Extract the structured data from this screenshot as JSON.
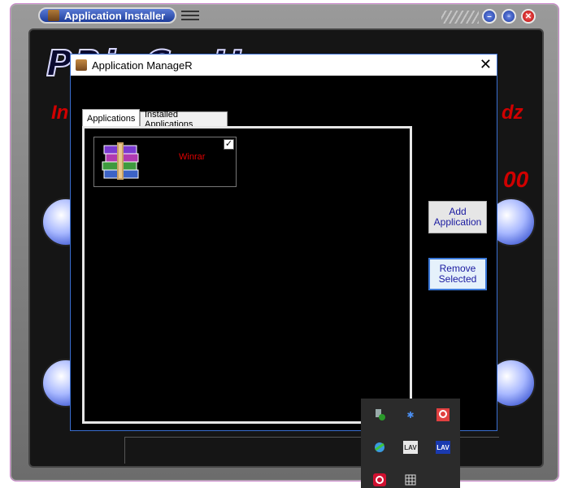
{
  "installer": {
    "title": "Application Installer",
    "brand_title": "PRinCe Hassan",
    "tagline_left": "In",
    "tagline_right": "dz",
    "number_text": "00"
  },
  "dialog": {
    "title": "Application ManageR",
    "close_glyph": "✕",
    "tabs": [
      {
        "label": "Applications",
        "active": true
      },
      {
        "label": "Installed Applications",
        "active": false
      }
    ],
    "apps": [
      {
        "name": "Winrar",
        "checked": true,
        "check_glyph": "✓"
      }
    ],
    "buttons": {
      "add_line1": "Add",
      "add_line2": "Application",
      "remove_line1": "Remove",
      "remove_line2": "Selected"
    }
  },
  "tray_icons": [
    {
      "name": "usb-safe-remove-icon"
    },
    {
      "name": "bluetooth-icon",
      "glyph": "✱"
    },
    {
      "name": "red-app-icon"
    },
    {
      "name": "network-globe-icon"
    },
    {
      "name": "lav-icon-white",
      "text": "LAV"
    },
    {
      "name": "lav-icon-blue",
      "text": "LAV"
    },
    {
      "name": "red-circle-app-icon"
    },
    {
      "name": "grid-app-icon"
    }
  ],
  "colors": {
    "accent_blue": "#3a78d8",
    "error_red": "#d00000",
    "dialog_bg": "#000000"
  }
}
